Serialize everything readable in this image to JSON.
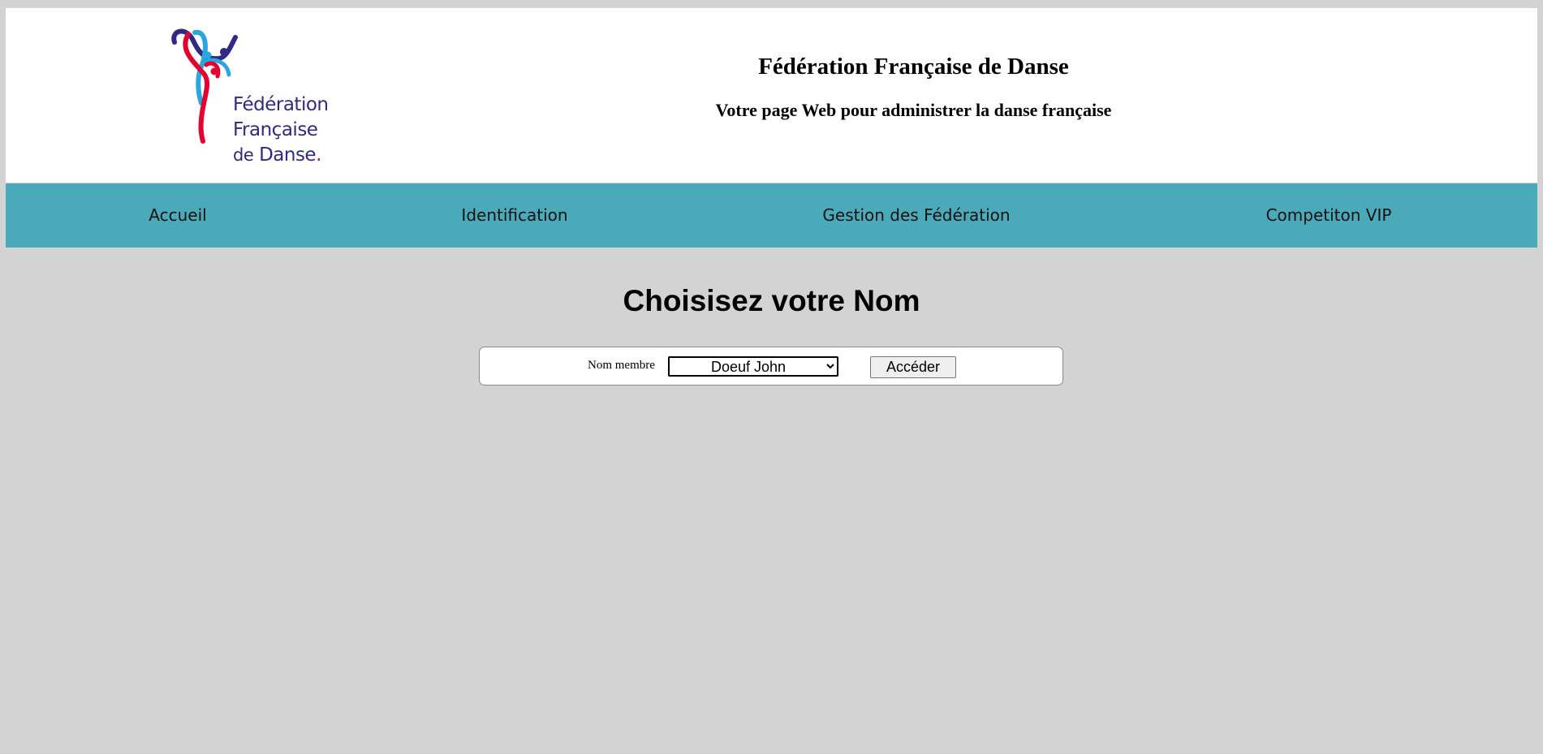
{
  "header": {
    "logo": {
      "line1": "Fédération",
      "line2": "Française",
      "line3_prefix": "de",
      "line3_main": "Danse",
      "line3_dot": "."
    },
    "title": "Fédération Française de Danse",
    "subtitle": "Votre page Web pour administrer la danse française"
  },
  "nav": {
    "items": [
      {
        "label": "Accueil"
      },
      {
        "label": "Identification"
      },
      {
        "label": "Gestion des Fédération"
      },
      {
        "label": "Competiton VIP"
      }
    ]
  },
  "main": {
    "heading": "Choisisez votre Nom",
    "form": {
      "label": "Nom membre",
      "selected_member": "Doeuf John",
      "submit_label": "Accéder"
    }
  },
  "colors": {
    "page_background": "#d3d3d3",
    "nav_background": "#4aaaba",
    "logo_navy": "#2e2a86",
    "logo_red": "#e4032e",
    "logo_blue": "#2aa7df"
  }
}
